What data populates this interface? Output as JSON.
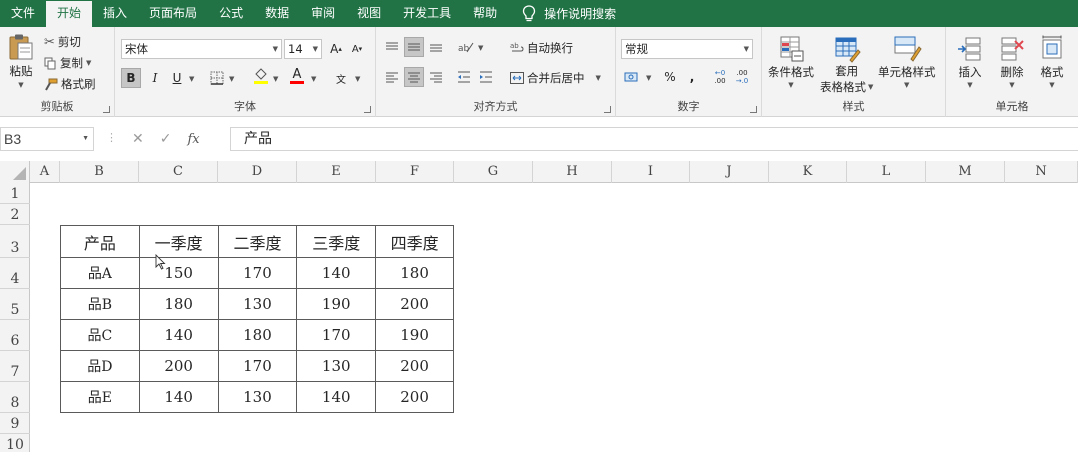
{
  "menu": {
    "items": [
      "文件",
      "开始",
      "插入",
      "页面布局",
      "公式",
      "数据",
      "审阅",
      "视图",
      "开发工具",
      "帮助"
    ],
    "active_index": 1,
    "tell_me": "操作说明搜索"
  },
  "ribbon": {
    "clipboard": {
      "label": "剪贴板",
      "paste": "粘贴",
      "cut": "剪切",
      "copy": "复制",
      "format_painter": "格式刷"
    },
    "font": {
      "label": "字体",
      "name": "宋体",
      "size": "14",
      "grow": "A",
      "shrink": "A",
      "bold": "B",
      "italic": "I",
      "underline": "U",
      "font_color_glyph": "A",
      "phonetic_glyph": "文"
    },
    "alignment": {
      "label": "对齐方式",
      "wrap_text": "自动换行",
      "merge_center": "合并后居中"
    },
    "number": {
      "label": "数字",
      "format": "常规",
      "percent": "%",
      "comma": ",",
      "inc_decimal_top": "←0",
      "inc_decimal_bottom": ".00",
      "dec_decimal_top": ".00",
      "dec_decimal_bottom": "→.0"
    },
    "styles": {
      "label": "样式",
      "conditional": "条件格式",
      "table_format_1": "套用",
      "table_format_2": "表格格式",
      "cell_styles": "单元格样式"
    },
    "cells": {
      "label": "单元格",
      "insert": "插入",
      "delete": "删除",
      "format": "格式"
    }
  },
  "formula_bar": {
    "name_box": "B3",
    "cancel": "✕",
    "enter": "✓",
    "fx": "fx",
    "content": "产品"
  },
  "sheet": {
    "columns": [
      "A",
      "B",
      "C",
      "D",
      "E",
      "F",
      "G",
      "H",
      "I",
      "J",
      "K",
      "L",
      "M",
      "N"
    ],
    "rows": [
      "1",
      "2",
      "3",
      "4",
      "5",
      "6",
      "7",
      "8",
      "9",
      "10"
    ],
    "table": {
      "headers": [
        "产品",
        "一季度",
        "二季度",
        "三季度",
        "四季度"
      ],
      "rows": [
        [
          "品A",
          "150",
          "170",
          "140",
          "180"
        ],
        [
          "品B",
          "180",
          "130",
          "190",
          "200"
        ],
        [
          "品C",
          "140",
          "180",
          "170",
          "190"
        ],
        [
          "品D",
          "200",
          "170",
          "130",
          "200"
        ],
        [
          "品E",
          "140",
          "130",
          "140",
          "200"
        ]
      ]
    }
  },
  "colors": {
    "accent": "#217346",
    "font_color_bar": "#ff0000",
    "highlight_bar": "#ffff00"
  }
}
